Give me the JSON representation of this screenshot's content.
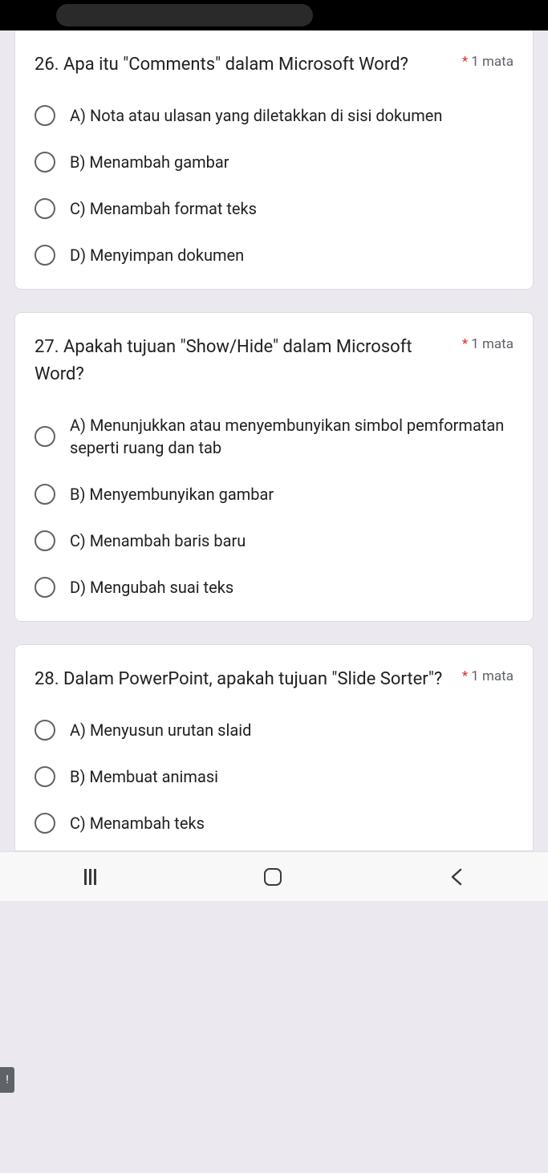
{
  "points_label": "1 mata",
  "required_mark": "*",
  "questions": [
    {
      "title": "26. Apa itu \"Comments\" dalam Microsoft Word?",
      "options": [
        "A) Nota atau ulasan yang diletakkan di sisi dokumen",
        "B) Menambah gambar",
        "C) Menambah format teks",
        "D) Menyimpan dokumen"
      ]
    },
    {
      "title": "27. Apakah tujuan \"Show/Hide\" dalam Microsoft Word?",
      "options": [
        "A) Menunjukkan atau menyembunyikan simbol pemformatan seperti ruang dan tab",
        "B) Menyembunyikan gambar",
        "C) Menambah baris baru",
        "D) Mengubah suai teks"
      ]
    },
    {
      "title": "28. Dalam PowerPoint, apakah tujuan \"Slide Sorter\"?",
      "options": [
        "A) Menyusun urutan slaid",
        "B) Membuat animasi",
        "C) Menambah teks"
      ]
    }
  ]
}
